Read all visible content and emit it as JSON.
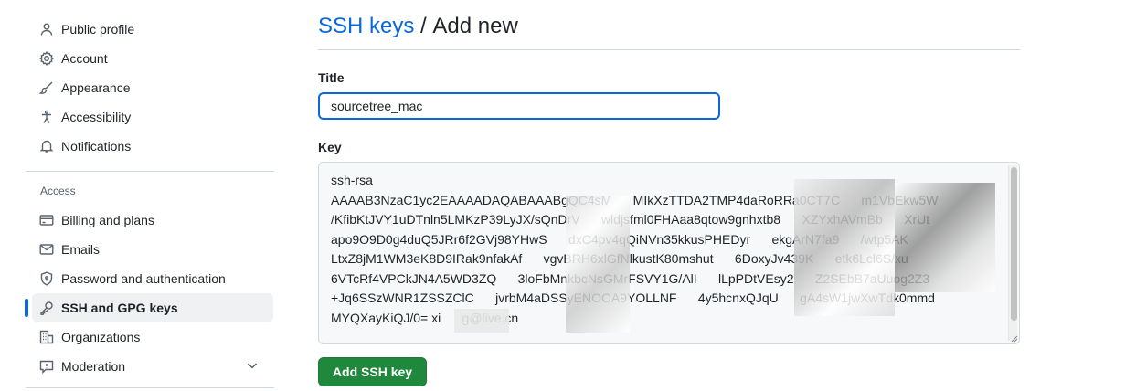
{
  "sidebar": {
    "items": [
      {
        "label": "Public profile",
        "icon": "person-icon"
      },
      {
        "label": "Account",
        "icon": "gear-icon"
      },
      {
        "label": "Appearance",
        "icon": "paintbrush-icon"
      },
      {
        "label": "Accessibility",
        "icon": "accessibility-icon"
      },
      {
        "label": "Notifications",
        "icon": "bell-icon"
      }
    ],
    "access_label": "Access",
    "access_items": [
      {
        "label": "Billing and plans",
        "icon": "credit-card-icon"
      },
      {
        "label": "Emails",
        "icon": "mail-icon"
      },
      {
        "label": "Password and authentication",
        "icon": "shield-lock-icon"
      },
      {
        "label": "SSH and GPG keys",
        "icon": "key-icon",
        "active": true
      },
      {
        "label": "Organizations",
        "icon": "organization-icon"
      },
      {
        "label": "Moderation",
        "icon": "report-icon"
      }
    ]
  },
  "header": {
    "link": "SSH keys",
    "separator": " / ",
    "title": "Add new"
  },
  "form": {
    "title_label": "Title",
    "title_value": "sourcetree_mac",
    "key_label": "Key",
    "key_value": "ssh-rsa\nAAAAB3NzaC1yc2EAAAADAQABAAABgQC4sM      MIkXzTTDA2TMP4daRoRRa0CT7C      m1VbEkw5W\n/KfibKtJVY1uDTnln5LMKzP39LyJX/sQnDrV      wldjsfml0FHAaa8qtow9gnhxtb8      XZYxhAVmBb      XrUt\napo9O9D0g4duQ5JRr6f2GVj98YHwS      dxC4pv4qQiNVn35kkusPHEDyr      ekgArN7fa9      /wtp5AK\nLtxZ8jM1WM3eK8D9IRak9nfakAf      vgvBRH6xlGfNlkustK80mshut      6DoxyJv439K      etk6Lcl6S/xu\n6VTcRf4VPCkJN4A5WD3ZQ      3loFbMnkbcNsGMrFSVY1G/AlI      lLpPDtVEsy2      Z2SEbB7aUuog2Z3\n+Jq6SSzWNR1ZSSZClC      jvrbM4aDSSyENOOA9YOLLNF      4y5hcnxQJqU      gA4sW1jwXwTdk0mmd\nMYQXayKiQJ/0= xi      g@live.cn",
    "submit_label": "Add SSH key"
  },
  "colors": {
    "link": "#0969da",
    "button": "#1f883d",
    "active_indicator": "#0969da"
  }
}
